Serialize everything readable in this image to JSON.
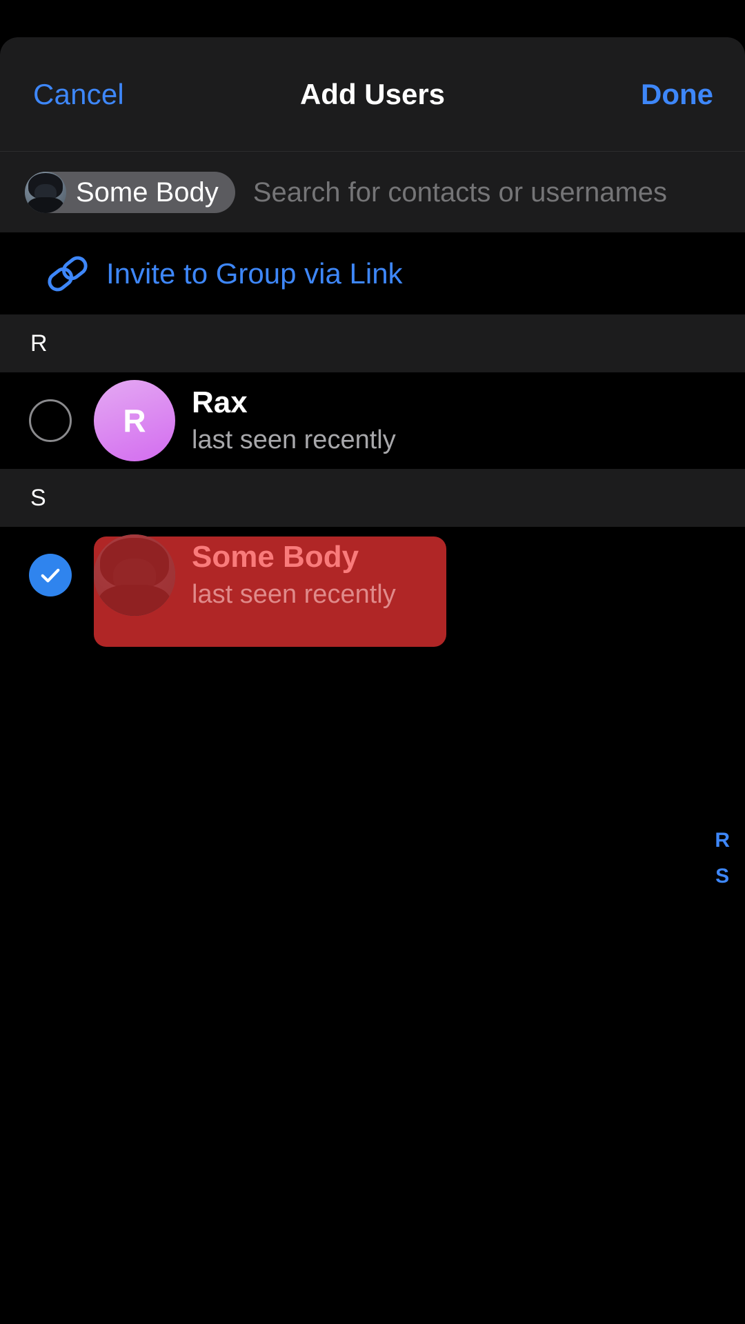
{
  "header": {
    "cancel_label": "Cancel",
    "title": "Add Users",
    "done_label": "Done"
  },
  "search": {
    "placeholder": "Search for contacts or usernames",
    "value": "",
    "tokens": [
      {
        "label": "Some Body",
        "avatar": "photo-avatar"
      }
    ]
  },
  "invite": {
    "icon": "link-icon",
    "label": "Invite to Group via Link"
  },
  "sections": [
    {
      "letter": "R",
      "contacts": [
        {
          "name": "Rax",
          "status": "last seen recently",
          "avatar_initial": "R",
          "avatar_type": "initial",
          "selected": false
        }
      ]
    },
    {
      "letter": "S",
      "contacts": [
        {
          "name": "Some Body",
          "status": "last seen recently",
          "avatar_initial": "",
          "avatar_type": "photo",
          "selected": true
        }
      ]
    }
  ],
  "index_bar": {
    "letters": [
      "R",
      "S"
    ]
  },
  "colors": {
    "accent_blue": "#3e87f9",
    "check_blue": "#2f84ee",
    "highlight_red": "#b02626",
    "selected_text_red": "#f97b7b",
    "sheet_bar": "#1c1c1d",
    "background": "#000000",
    "avatar_rax_start": "#e4a9f2",
    "avatar_rax_end": "#d36cf0"
  }
}
